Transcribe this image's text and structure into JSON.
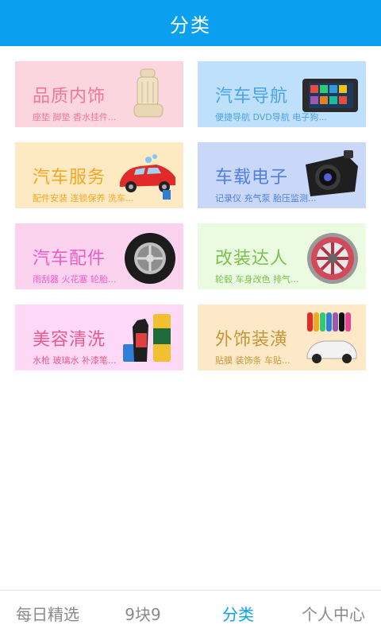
{
  "header": {
    "title": "分类"
  },
  "cards": [
    {
      "title": "品质内饰",
      "subtitle": "座垫 脚垫 香水挂件...",
      "bg": "#fbd6df",
      "color": "#f0789a",
      "icon": "car-seat-icon"
    },
    {
      "title": "汽车导航",
      "subtitle": "便捷导航 DVD导航 电子狗...",
      "bg": "#bfe0fb",
      "color": "#4aa3e6",
      "icon": "gps-navigator-icon"
    },
    {
      "title": "汽车服务",
      "subtitle": "配件安装 连锁保养 洗车...",
      "bg": "#fde9c2",
      "color": "#f5a623",
      "icon": "car-wash-icon"
    },
    {
      "title": "车载电子",
      "subtitle": "记录仪 充气泵 胎压监测...",
      "bg": "#c9d8f8",
      "color": "#4f7fe0",
      "icon": "dashcam-icon"
    },
    {
      "title": "汽车配件",
      "subtitle": "雨刮器 火花塞 轮胎...",
      "bg": "#fcd3ef",
      "color": "#ea5fc4",
      "icon": "tire-icon"
    },
    {
      "title": "改装达人",
      "subtitle": "轮毂 车身改色 排气...",
      "bg": "#ebfbe2",
      "color": "#7cc04e",
      "icon": "alloy-wheel-icon"
    },
    {
      "title": "美容清洗",
      "subtitle": "水枪 玻璃水 补漆笔...",
      "bg": "#fdd8f7",
      "color": "#ea5a8a",
      "icon": "cleaning-products-icon"
    },
    {
      "title": "外饰装潢",
      "subtitle": "贴膜 装饰条 车贴...",
      "bg": "#fde9c8",
      "color": "#c7963a",
      "icon": "car-wrap-icon"
    }
  ],
  "tabs": [
    {
      "label": "每日精选",
      "active": false
    },
    {
      "label": "9块9",
      "active": false
    },
    {
      "label": "分类",
      "active": true
    },
    {
      "label": "个人中心",
      "active": false
    }
  ]
}
